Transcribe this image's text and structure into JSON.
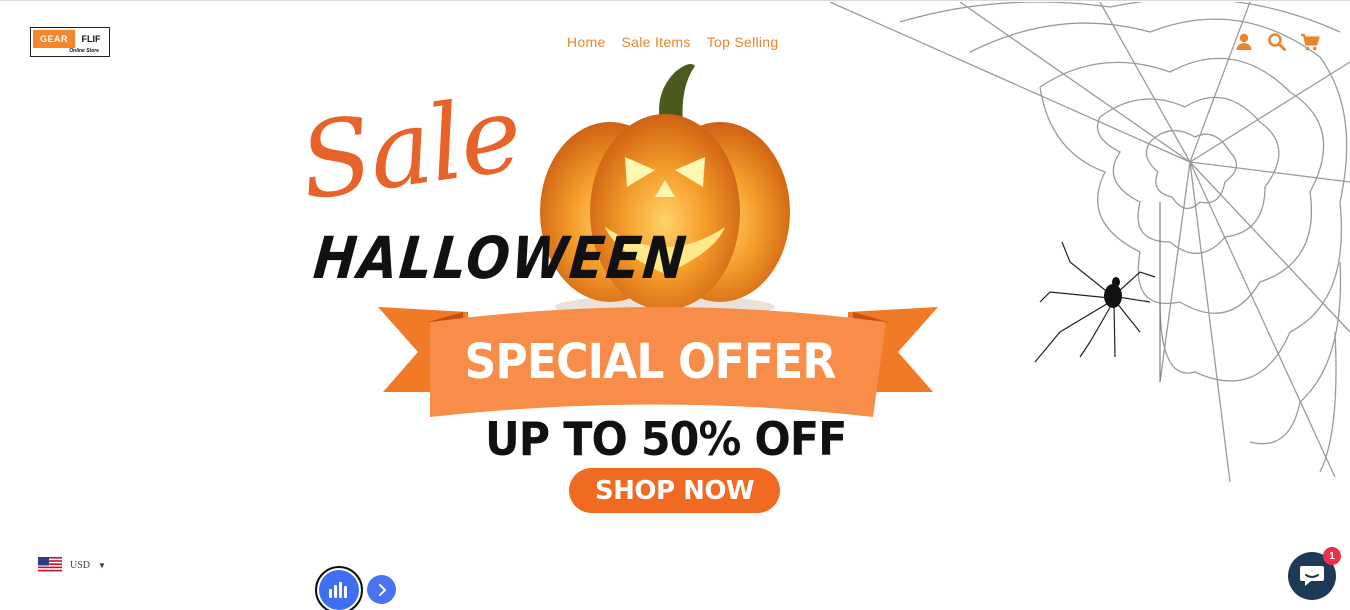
{
  "header": {
    "logo": {
      "brand_left": "GEAR",
      "brand_right": "FLIF",
      "tagline": "Online Store"
    },
    "nav": [
      {
        "label": "Home"
      },
      {
        "label": "Sale Items"
      },
      {
        "label": "Top Selling"
      }
    ],
    "icons": [
      "account-icon",
      "search-icon",
      "cart-icon"
    ],
    "accent_color": "#e9862c"
  },
  "hero": {
    "sale_word": "Sale",
    "holiday": "HALLOWEEN",
    "ribbon_text": "SPECIAL OFFER",
    "discount_text": "UP TO 50% OFF",
    "cta_label": "SHOP NOW",
    "cta_color": "#f06a22",
    "ribbon_color": "#f5853a"
  },
  "footer": {
    "currency_code": "USD",
    "chat_badge_count": "1"
  }
}
